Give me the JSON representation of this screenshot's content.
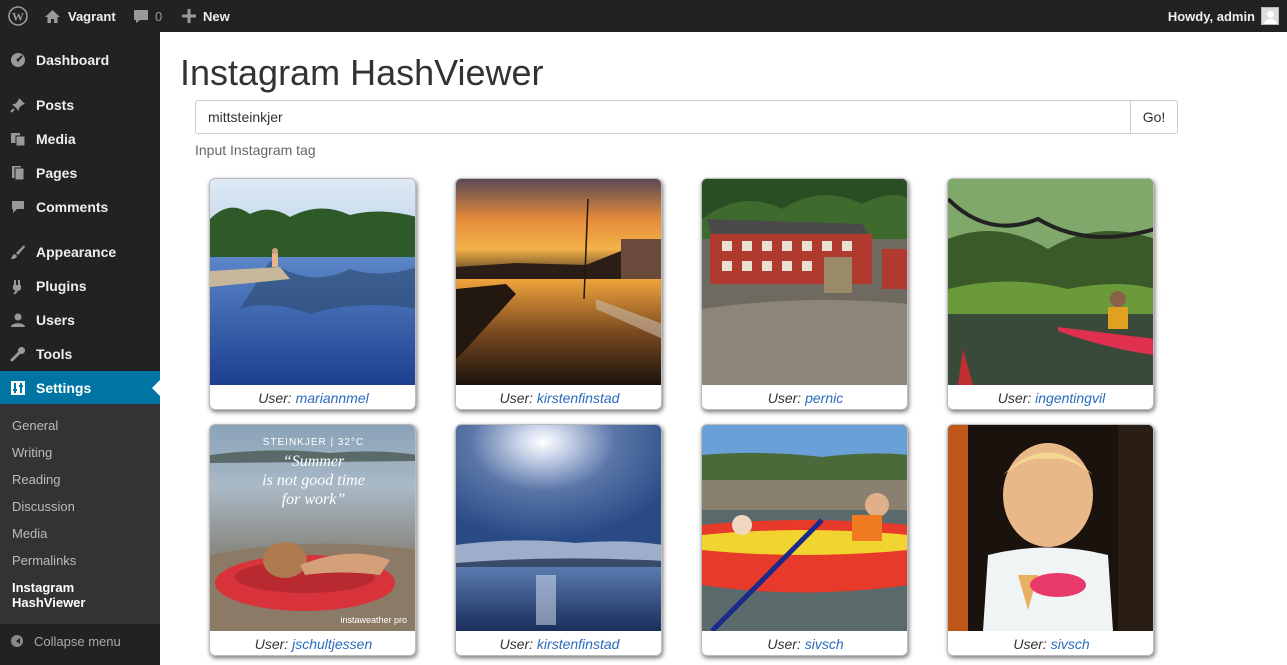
{
  "adminbar": {
    "site_name": "Vagrant",
    "comments_count": "0",
    "new_label": "New",
    "howdy": "Howdy, admin"
  },
  "sidebar": {
    "items": [
      {
        "label": "Dashboard",
        "icon": "dashboard-icon"
      },
      {
        "label": "Posts",
        "icon": "pin-icon"
      },
      {
        "label": "Media",
        "icon": "media-icon"
      },
      {
        "label": "Pages",
        "icon": "pages-icon"
      },
      {
        "label": "Comments",
        "icon": "comment-icon"
      },
      {
        "label": "Appearance",
        "icon": "brush-icon"
      },
      {
        "label": "Plugins",
        "icon": "plug-icon"
      },
      {
        "label": "Users",
        "icon": "user-icon"
      },
      {
        "label": "Tools",
        "icon": "wrench-icon"
      },
      {
        "label": "Settings",
        "icon": "settings-icon"
      }
    ],
    "submenu": [
      "General",
      "Writing",
      "Reading",
      "Discussion",
      "Media",
      "Permalinks",
      "Instagram HashViewer"
    ],
    "collapse_label": "Collapse menu"
  },
  "main": {
    "title": "Instagram HashViewer",
    "search_value": "mittsteinkjer",
    "go_label": "Go!",
    "help_text": "Input Instagram tag",
    "user_prefix": "User:",
    "photos": [
      {
        "user": "mariannmel"
      },
      {
        "user": "kirstenfinstad"
      },
      {
        "user": "pernic"
      },
      {
        "user": "ingentingvil"
      },
      {
        "user": "jschultjessen",
        "overlay": [
          "STEINKJER | 32°C",
          "“Summer",
          "is not good time",
          "for work”"
        ],
        "watermark": "instaweather pro"
      },
      {
        "user": "kirstenfinstad"
      },
      {
        "user": "sivsch"
      },
      {
        "user": "sivsch"
      }
    ]
  },
  "colors": {
    "adminbar_bg": "#222222",
    "active_menu": "#0074a2",
    "link": "#2a6bbd"
  }
}
